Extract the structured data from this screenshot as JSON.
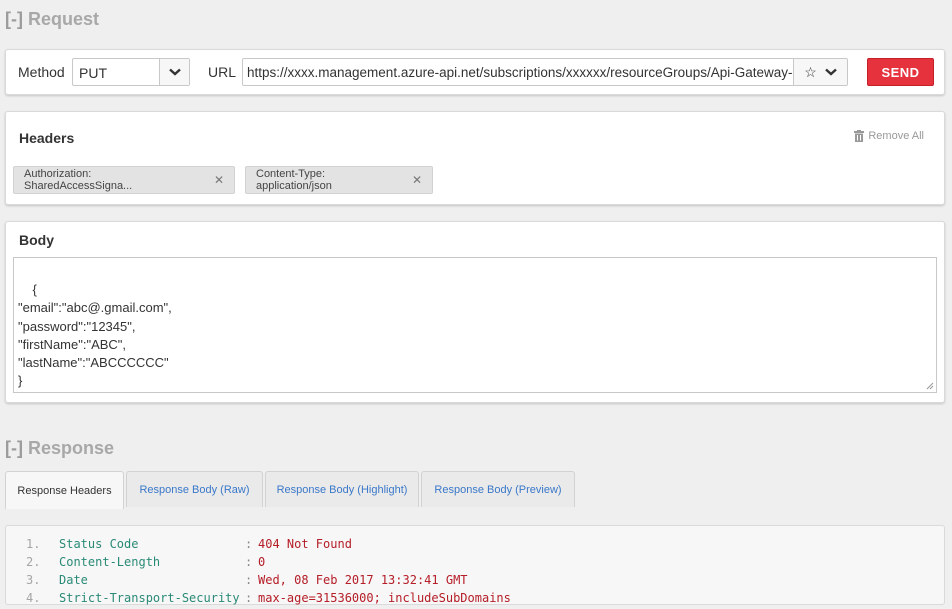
{
  "request": {
    "toggle": "[-]",
    "title": "Request",
    "method_label": "Method",
    "method_value": "PUT",
    "url_label": "URL",
    "url_value": "https://xxxx.management.azure-api.net/subscriptions/xxxxxx/resourceGroups/Api-Gateway-Sa",
    "send_label": "SEND"
  },
  "headers": {
    "title": "Headers",
    "remove_all": "Remove All",
    "items": [
      {
        "label": "Authorization: SharedAccessSigna..."
      },
      {
        "label": "Content-Type: application/json"
      }
    ]
  },
  "body": {
    "title": "Body",
    "content": "{\n\"email\":\"abc@.gmail.com\",\n\"password\":\"12345\",\n\"firstName\":\"ABC\",\n\"lastName\":\"ABCCCCCC\"\n}"
  },
  "response": {
    "toggle": "[-]",
    "title": "Response",
    "tabs": [
      {
        "label": "Response Headers",
        "active": true
      },
      {
        "label": "Response Body (Raw)",
        "active": false
      },
      {
        "label": "Response Body (Highlight)",
        "active": false
      },
      {
        "label": "Response Body (Preview)",
        "active": false
      }
    ],
    "rows": [
      {
        "num": "1.",
        "key": "Status Code",
        "sep": ":",
        "value": "404 Not Found"
      },
      {
        "num": "2.",
        "key": "Content-Length",
        "sep": ":",
        "value": "0"
      },
      {
        "num": "3.",
        "key": "Date",
        "sep": ":",
        "value": "Wed, 08 Feb 2017 13:32:41 GMT"
      },
      {
        "num": "4.",
        "key": "Strict-Transport-Security",
        "sep": ":",
        "value": "max-age=31536000; includeSubDomains"
      }
    ]
  },
  "colors": {
    "send": "#e5323d",
    "tab_link": "#3a78c9",
    "resp_key": "#2a8a76",
    "resp_value": "#b51d27"
  },
  "icons": {
    "method_dropdown": "chevron-down-icon",
    "favorite": "star-icon",
    "url_dropdown": "chevron-down-icon",
    "remove_all": "trash-icon",
    "chip_remove": "close-icon"
  }
}
